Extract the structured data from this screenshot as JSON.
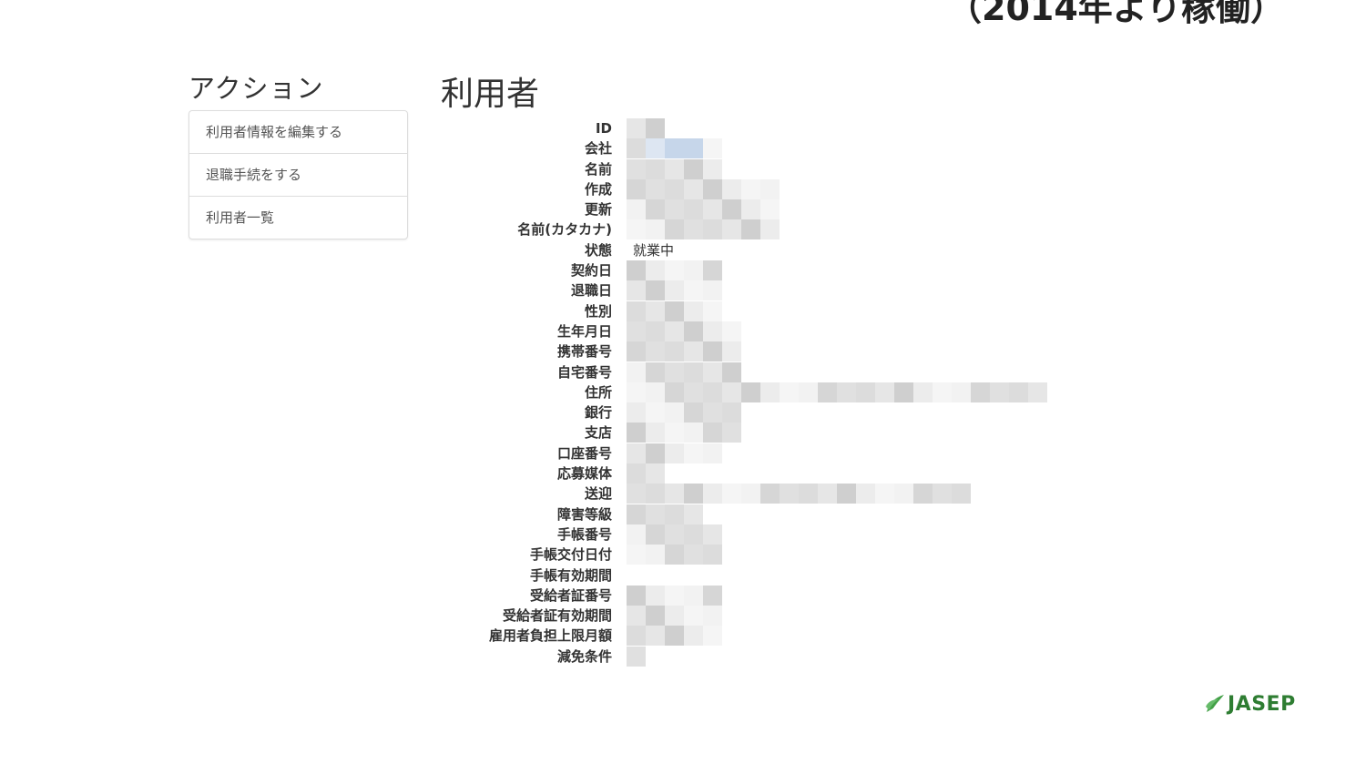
{
  "header": {
    "note": "（2014年より稼働）"
  },
  "sidebar": {
    "title": "アクション",
    "items": [
      {
        "label": "利用者情報を編集する"
      },
      {
        "label": "退職手続をする"
      },
      {
        "label": "利用者一覧"
      }
    ]
  },
  "main": {
    "title": "利用者",
    "fields": [
      {
        "label": "ID",
        "value": ""
      },
      {
        "label": "会社",
        "value": ""
      },
      {
        "label": "名前",
        "value": ""
      },
      {
        "label": "作成",
        "value": ""
      },
      {
        "label": "更新",
        "value": ""
      },
      {
        "label": "名前(カタカナ)",
        "value": ""
      },
      {
        "label": "状態",
        "value": "就業中"
      },
      {
        "label": "契約日",
        "value": ""
      },
      {
        "label": "退職日",
        "value": ""
      },
      {
        "label": "性別",
        "value": ""
      },
      {
        "label": "生年月日",
        "value": ""
      },
      {
        "label": "携帯番号",
        "value": ""
      },
      {
        "label": "自宅番号",
        "value": ""
      },
      {
        "label": "住所",
        "value": ""
      },
      {
        "label": "銀行",
        "value": ""
      },
      {
        "label": "支店",
        "value": ""
      },
      {
        "label": "口座番号",
        "value": ""
      },
      {
        "label": "応募媒体",
        "value": ""
      },
      {
        "label": "送迎",
        "value": ""
      },
      {
        "label": "障害等級",
        "value": ""
      },
      {
        "label": "手帳番号",
        "value": ""
      },
      {
        "label": "手帳交付日付",
        "value": ""
      },
      {
        "label": "手帳有効期間",
        "value": ""
      },
      {
        "label": "受給者証番号",
        "value": ""
      },
      {
        "label": "受給者証有効期間",
        "value": ""
      },
      {
        "label": "雇用者負担上限月額",
        "value": ""
      },
      {
        "label": "減免条件",
        "value": ""
      }
    ]
  },
  "logo": {
    "text": "JASEP",
    "color": "#2e7d32"
  }
}
